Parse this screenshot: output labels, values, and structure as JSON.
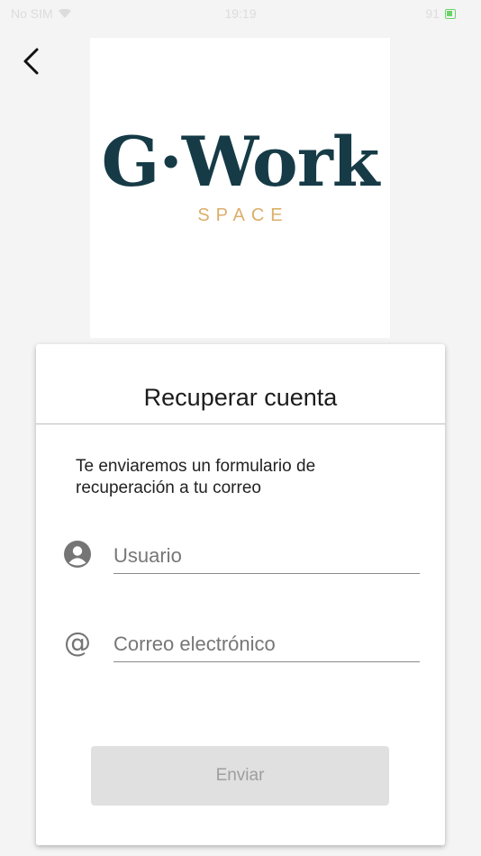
{
  "status_bar": {
    "carrier": "No SIM",
    "time": "19:19",
    "battery": "91"
  },
  "logo": {
    "main": "G·Work",
    "sub": "SPACE",
    "main_color": "#163b47",
    "sub_color": "#dcae6a"
  },
  "card": {
    "title": "Recuperar cuenta",
    "description": "Te enviaremos un formulario de recuperación a tu correo",
    "fields": [
      {
        "icon": "user-icon",
        "placeholder": "Usuario",
        "value": ""
      },
      {
        "icon": "at-icon",
        "placeholder": "Correo electrónico",
        "value": ""
      }
    ],
    "submit_label": "Enviar"
  },
  "colors": {
    "button_disabled_bg": "#e0e0e0",
    "button_disabled_text": "#9e9e9e"
  }
}
